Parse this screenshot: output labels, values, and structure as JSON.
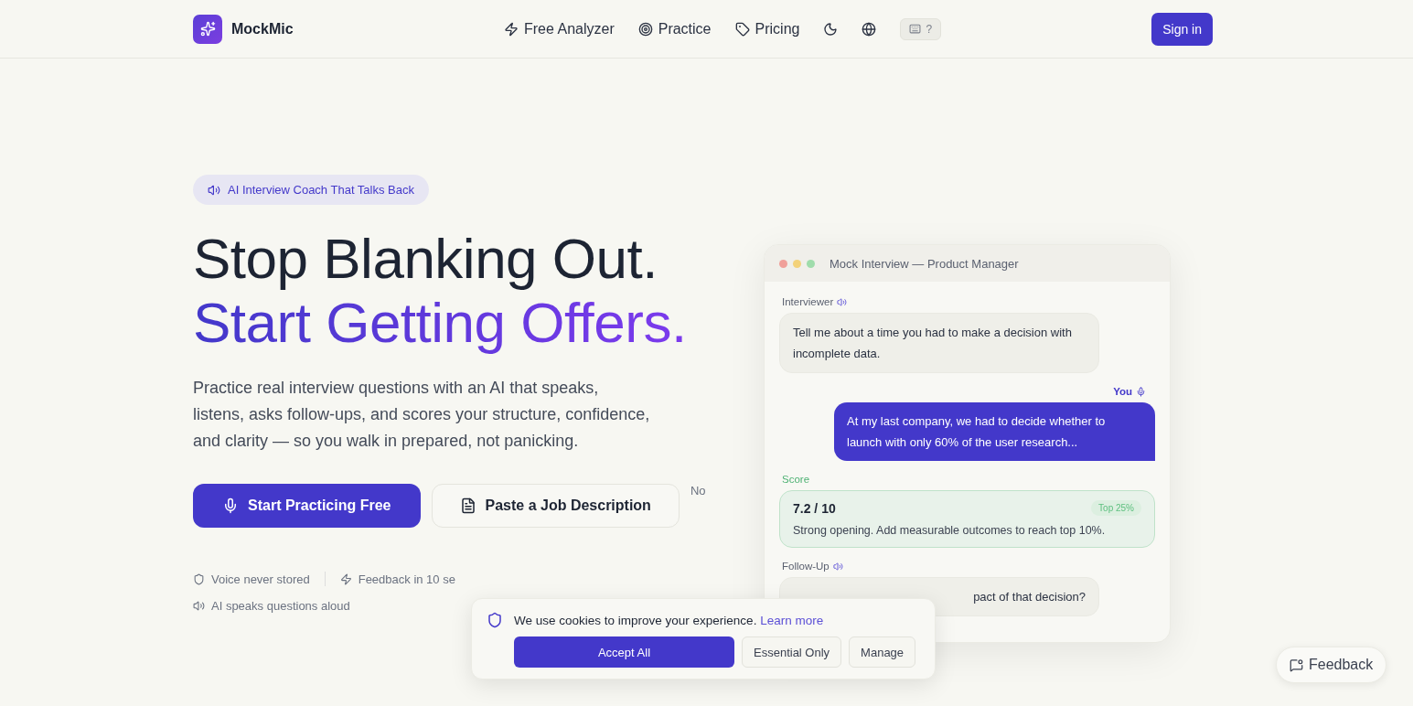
{
  "brand": {
    "name": "MockMic"
  },
  "nav": [
    {
      "label": "Free Analyzer"
    },
    {
      "label": "Practice"
    },
    {
      "label": "Pricing"
    }
  ],
  "shortcut_hint": "?",
  "sign_in": "Sign in",
  "hero": {
    "badge": "AI Interview Coach That Talks Back",
    "title_dark": "Stop Blanking Out.",
    "title_accent": "Start Getting Offers.",
    "description": "Practice real interview questions with an AI that speaks, listens, asks follow-ups, and scores your structure, confidence, and clarity — so you walk in prepared, not panicking.",
    "primary_button": "Start Practicing Free",
    "secondary_button": "Paste a Job Description",
    "side_note": "No",
    "trust": [
      {
        "label": "Voice never stored"
      },
      {
        "label": "Feedback in 10 se"
      }
    ],
    "trust_more": "AI speaks questions aloud"
  },
  "mock": {
    "title": "Mock Interview — Product Manager",
    "messages": [
      {
        "kind": "interviewer",
        "label": "Interviewer",
        "text": "Tell me about a time you had to make a decision with incomplete data."
      },
      {
        "kind": "you",
        "label": "You",
        "text": "At my last company, we had to decide whether to launch with only 60% of the user research..."
      },
      {
        "kind": "score",
        "label": "Score",
        "score": "7.2 / 10",
        "badge": "Top 25%",
        "text": "Strong opening. Add measurable outcomes to reach top 10%."
      },
      {
        "kind": "interviewer",
        "label": "Follow-Up",
        "text": "pact of that decision?"
      }
    ]
  },
  "cookie": {
    "text": "We use cookies to improve your experience.",
    "link": "Learn more",
    "buttons": [
      {
        "label": "Accept All",
        "primary": true
      },
      {
        "label": "Essential Only",
        "primary": false
      },
      {
        "label": "Manage",
        "primary": false
      }
    ]
  },
  "feedback_button": "Feedback"
}
